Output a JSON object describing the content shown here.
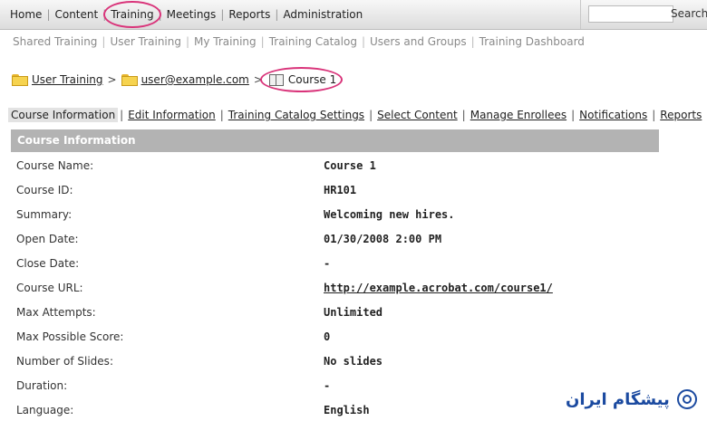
{
  "topnav": {
    "items": [
      "Home",
      "Content",
      "Training",
      "Meetings",
      "Reports",
      "Administration"
    ],
    "search_button": "Search",
    "search_placeholder": ""
  },
  "subnav": {
    "items": [
      "Shared Training",
      "User Training",
      "My Training",
      "Training Catalog",
      "Users and Groups",
      "Training Dashboard"
    ]
  },
  "breadcrumb": {
    "items": [
      "User Training",
      "user@example.com",
      "Course 1"
    ],
    "separator": ">"
  },
  "tabs": {
    "items": [
      "Course Information",
      "Edit Information",
      "Training Catalog Settings",
      "Select Content",
      "Manage Enrollees",
      "Notifications",
      "Reports"
    ],
    "active": "Course Information"
  },
  "section": {
    "title": "Course Information"
  },
  "fields": [
    {
      "label": "Course Name:",
      "value": "Course 1"
    },
    {
      "label": "Course ID:",
      "value": "HR101"
    },
    {
      "label": "Summary:",
      "value": "Welcoming new hires."
    },
    {
      "label": "Open Date:",
      "value": "01/30/2008 2:00 PM"
    },
    {
      "label": "Close Date:",
      "value": "-"
    },
    {
      "label": "Course URL:",
      "value": "http://example.acrobat.com/course1/"
    },
    {
      "label": "Max Attempts:",
      "value": "Unlimited"
    },
    {
      "label": "Max Possible Score:",
      "value": "0"
    },
    {
      "label": "Number of Slides:",
      "value": "No slides"
    },
    {
      "label": "Duration:",
      "value": "-"
    },
    {
      "label": "Language:",
      "value": "English"
    }
  ],
  "watermark": {
    "text": "پیشگام ایران"
  },
  "colors": {
    "highlight_circle": "#d9347a",
    "section_header_bg": "#b3b3b3",
    "logo_blue": "#1b4aa0"
  }
}
